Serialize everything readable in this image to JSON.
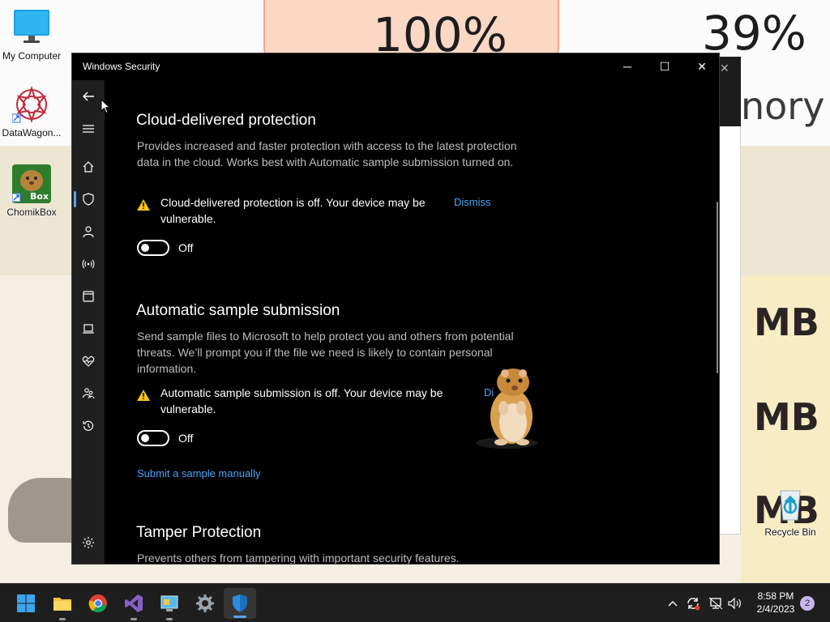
{
  "desktop": {
    "background": {
      "big_percent_left": "100%",
      "big_percent_right": "39%",
      "fragment_text": "nory",
      "mb_labels": [
        "MB",
        "MB",
        "MB"
      ]
    },
    "icons": [
      {
        "label": "My Computer",
        "icon": "monitor-icon"
      },
      {
        "label": "DataWagon...",
        "icon": "mandala-icon"
      },
      {
        "label": "ChomikBox",
        "icon": "chomikbox-icon",
        "badge": "Box"
      },
      {
        "label": "Recycle Bin",
        "icon": "recycle-bin-icon"
      }
    ]
  },
  "window": {
    "title": "Windows Security",
    "controls": {
      "minimize": "─",
      "maximize": "☐",
      "close": "✕"
    },
    "sections": [
      {
        "title": "Cloud-delivered protection",
        "description": "Provides increased and faster protection with access to the latest protection data in the cloud. Works best with Automatic sample submission turned on.",
        "warning": "Cloud-delivered protection is off. Your device may be vulnerable.",
        "dismiss": "Dismiss",
        "toggle_label": "Off"
      },
      {
        "title": "Automatic sample submission",
        "description": "Send sample files to Microsoft to help protect you and others from potential threats. We’ll prompt you if the file we need is likely to contain personal information.",
        "warning": "Automatic sample submission is off. Your device may be vulnerable.",
        "dismiss": "Di",
        "toggle_label": "Off",
        "link": "Submit a sample manually"
      },
      {
        "title": "Tamper Protection",
        "description": "Prevents others from tampering with important security features."
      }
    ],
    "nav_icons": [
      "back-arrow-icon",
      "hamburger-menu-icon",
      "home-icon",
      "shield-icon",
      "person-icon",
      "wireless-icon",
      "app-browser-icon",
      "laptop-icon",
      "heart-pulse-icon",
      "family-icon",
      "history-icon",
      "settings-gear-icon"
    ]
  },
  "taskbar": {
    "apps": [
      "windows-start-icon",
      "file-explorer-icon",
      "chrome-icon",
      "visual-studio-icon",
      "control-panel-icon",
      "settings-icon",
      "windows-security-icon"
    ],
    "tray": {
      "time": "8:58 PM",
      "date": "2/4/2023",
      "notifications": "2"
    }
  },
  "colors": {
    "accent": "#4aa3f7",
    "window_bg": "#000000",
    "nav_bg": "#1f1f1f",
    "warning": "#f5c518"
  }
}
